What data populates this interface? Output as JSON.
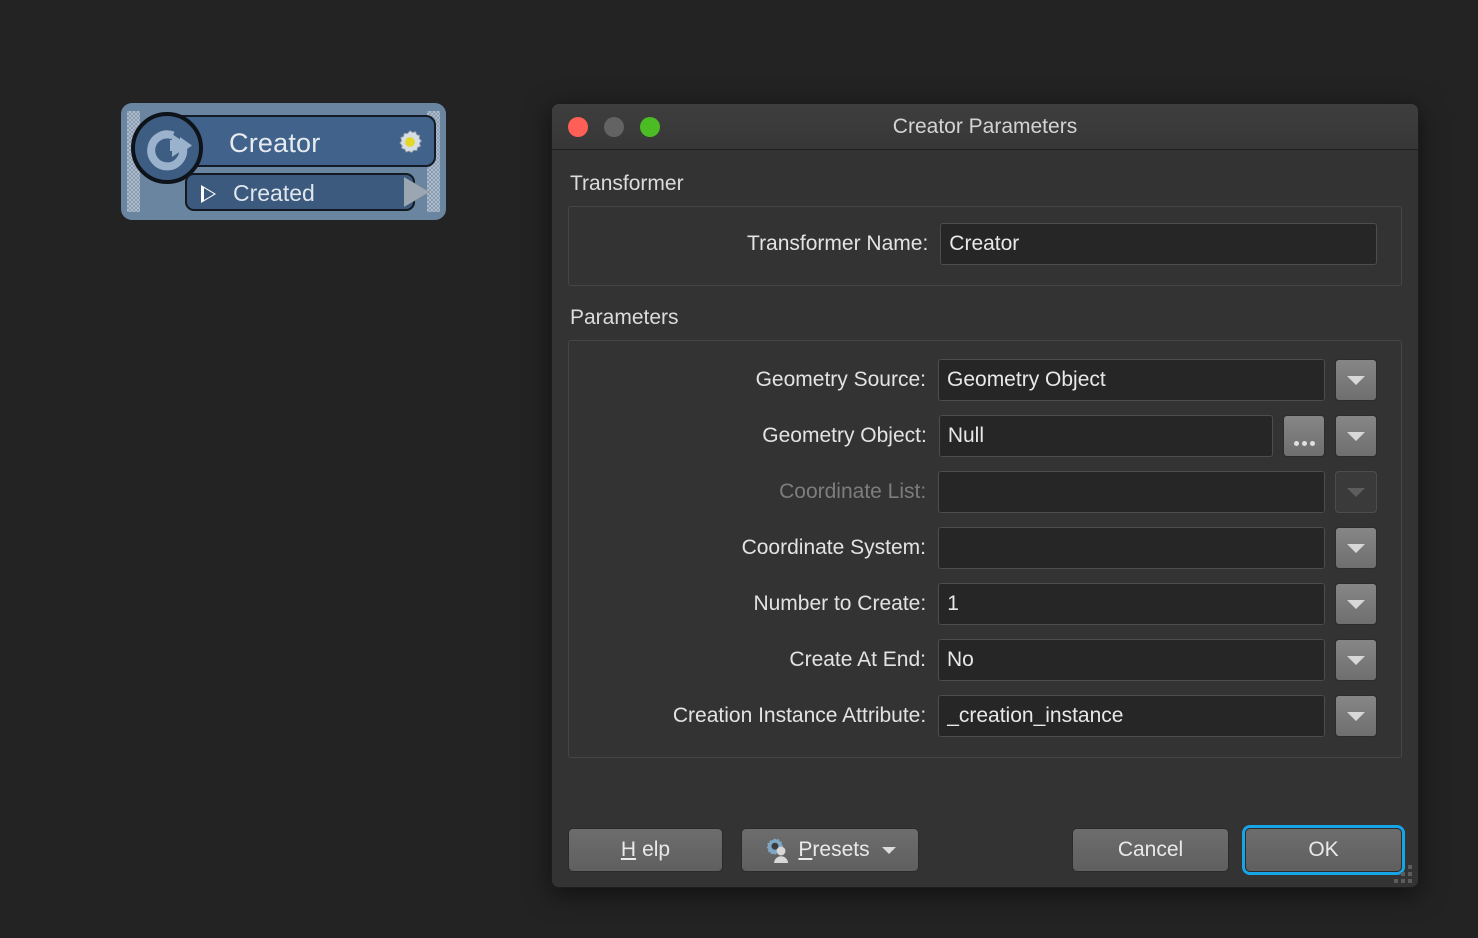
{
  "node": {
    "title": "Creator",
    "output_port": "Created",
    "icon": "creator-loop-arrow-icon",
    "gear_icon": "gear-icon",
    "colors": {
      "body": "#6a85a0",
      "header": "#41628a",
      "port": "#3c5a7d",
      "gear_center": "#e3d727"
    }
  },
  "dialog": {
    "title": "Creator Parameters",
    "window_controls": {
      "close": "close-traffic-light",
      "minimize": "minimize-traffic-light",
      "zoom": "zoom-traffic-light",
      "close_color": "#ff5f56",
      "minimize_color": "#636363",
      "zoom_color": "#4cbc24"
    },
    "sections": {
      "transformer": {
        "heading": "Transformer",
        "name_label": "Transformer Name:",
        "name_value": "Creator"
      },
      "parameters": {
        "heading": "Parameters",
        "rows": [
          {
            "label": "Geometry Source:",
            "value": "Geometry Object",
            "control": "combobox",
            "disabled": false,
            "has_browse": false,
            "side_button": "dropdown-arrow-button"
          },
          {
            "label": "Geometry Object:",
            "value": "Null",
            "control": "text",
            "disabled": false,
            "has_browse": true,
            "browse_label": "...",
            "side_button": "dropdown-arrow-button"
          },
          {
            "label": "Coordinate List:",
            "value": "",
            "control": "text",
            "disabled": true,
            "has_browse": false,
            "side_button": "dropdown-arrow-button"
          },
          {
            "label": "Coordinate System:",
            "value": "",
            "control": "combobox",
            "disabled": false,
            "has_browse": false,
            "side_button": "dropdown-arrow-button"
          },
          {
            "label": "Number to Create:",
            "value": "1",
            "control": "text",
            "disabled": false,
            "has_browse": false,
            "side_button": "dropdown-arrow-button"
          },
          {
            "label": "Create At End:",
            "value": "No",
            "control": "combobox",
            "disabled": false,
            "has_browse": false,
            "side_button": "dropdown-arrow-button"
          },
          {
            "label": "Creation Instance Attribute:",
            "value": "_creation_instance",
            "control": "text",
            "disabled": false,
            "has_browse": false,
            "side_button": "dropdown-arrow-button"
          }
        ]
      }
    },
    "footer": {
      "help": {
        "mnemonic": "H",
        "rest": "elp"
      },
      "presets": {
        "mnemonic": "P",
        "rest": "resets",
        "icon": "gear-person-icon"
      },
      "cancel": "Cancel",
      "ok": "OK",
      "ok_focus_color": "#18a5e8"
    },
    "resize_grip": "resize-grip"
  }
}
